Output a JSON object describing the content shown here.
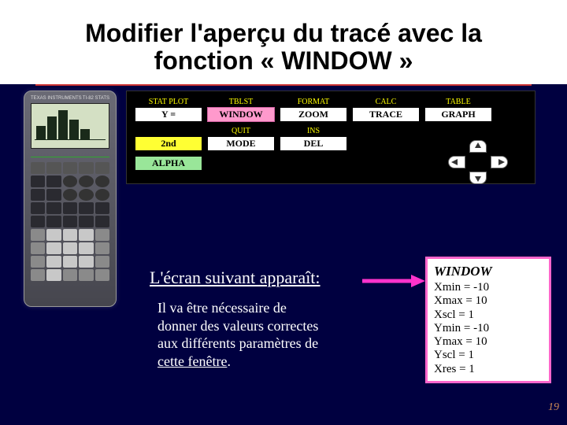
{
  "title_line1": "Modifier l'aperçu du tracé avec la",
  "title_line2": "fonction « WINDOW »",
  "calc": {
    "brand_left": "TEXAS INSTRUMENTS",
    "brand_right": "TI-82 STATS"
  },
  "keyboard": {
    "row1_yellow": [
      "STAT PLOT",
      "TBLST",
      "FORMAT",
      "CALC",
      "TABLE"
    ],
    "row1_keys": [
      "Y =",
      "WINDOW",
      "ZOOM",
      "TRACE",
      "GRAPH"
    ],
    "row2_yellow": [
      "QUIT",
      "INS"
    ],
    "row2_keys": [
      "2nd",
      "MODE",
      "DEL"
    ],
    "row3_keys": [
      "ALPHA"
    ]
  },
  "caption": "L'écran suivant apparaît:",
  "desc_lines": [
    "Il va être nécessaire de",
    "donner des valeurs correctes",
    "aux différents paramètres de",
    "cette fenêtre"
  ],
  "window_panel": {
    "title": "WINDOW",
    "lines": [
      "Xmin = -10",
      "Xmax = 10",
      "Xscl = 1",
      "Ymin = -10",
      "Ymax = 10",
      "Yscl = 1",
      "Xres = 1"
    ]
  },
  "page_number": "19"
}
